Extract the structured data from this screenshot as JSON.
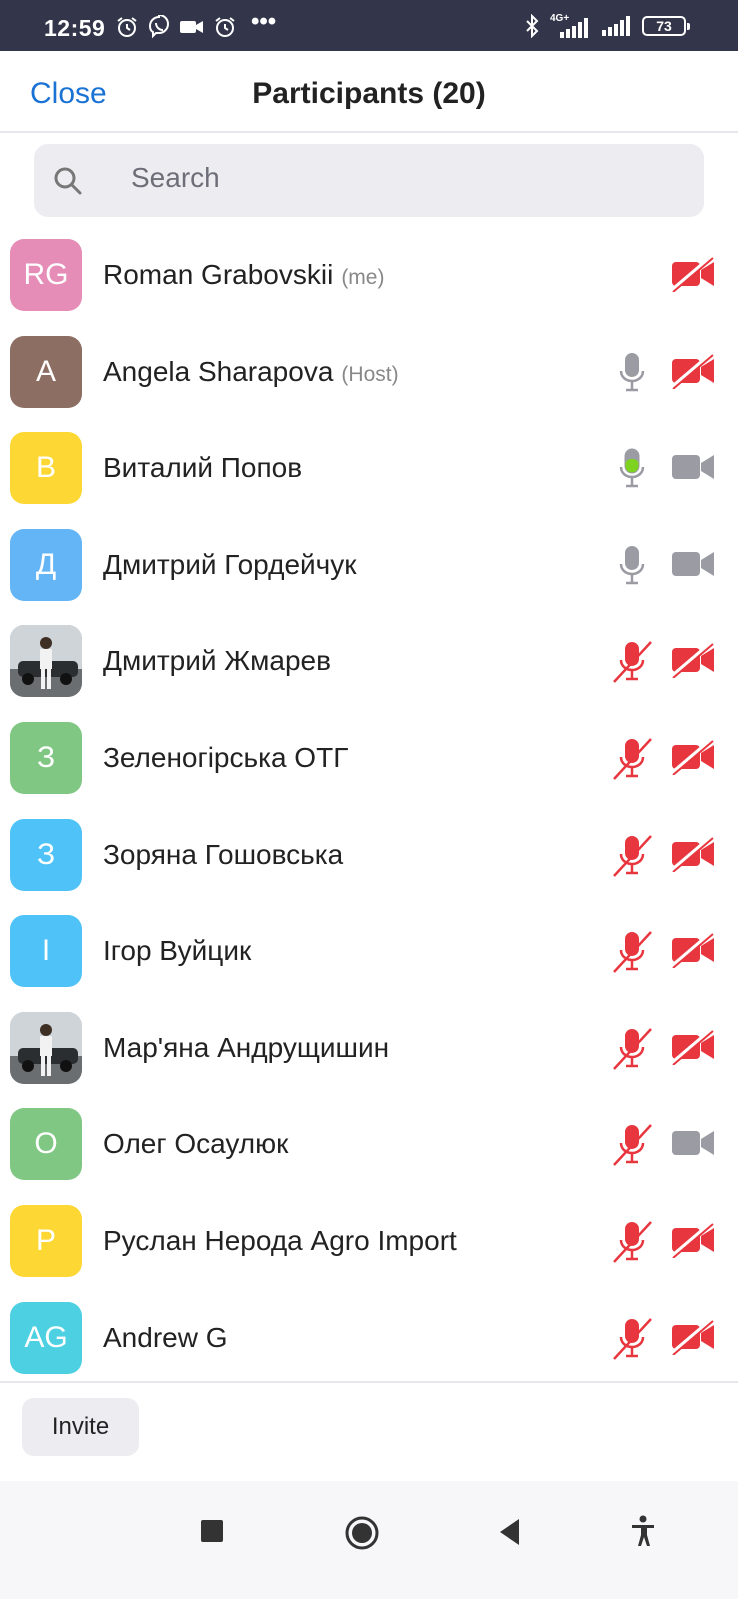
{
  "status_bar": {
    "time": "12:59",
    "dots": "•••",
    "net_label_top": "4G+",
    "battery": "73"
  },
  "header": {
    "close_label": "Close",
    "title": "Participants (20)"
  },
  "search": {
    "placeholder": "Search"
  },
  "colors": {
    "accent": "#1a73d4",
    "muted_red": "#e8363f",
    "active_green": "#7ed321",
    "icon_gray": "#9b9ba3"
  },
  "participants": [
    {
      "initials": "RG",
      "name": "Roman Grabovskii",
      "tag": "(me)",
      "avatar_color": "#e58cb7",
      "photo": false,
      "mic": "none",
      "cam": "off"
    },
    {
      "initials": "A",
      "name": "Angela Sharapova",
      "tag": "(Host)",
      "avatar_color": "#8d6e63",
      "photo": false,
      "mic": "on",
      "cam": "off"
    },
    {
      "initials": "В",
      "name": "Виталий Попов",
      "tag": "",
      "avatar_color": "#fdd835",
      "photo": false,
      "mic": "speaking",
      "cam": "on"
    },
    {
      "initials": "Д",
      "name": "Дмитрий Гордейчук",
      "tag": "",
      "avatar_color": "#64b5f6",
      "photo": false,
      "mic": "on",
      "cam": "on"
    },
    {
      "initials": "",
      "name": "Дмитрий Жмарев",
      "tag": "",
      "avatar_color": "#9aa0a6",
      "photo": true,
      "mic": "muted",
      "cam": "off"
    },
    {
      "initials": "З",
      "name": "Зеленогірська ОТГ",
      "tag": "",
      "avatar_color": "#81c784",
      "photo": false,
      "mic": "muted",
      "cam": "off"
    },
    {
      "initials": "З",
      "name": "Зоряна Гошовська",
      "tag": "",
      "avatar_color": "#4fc3f7",
      "photo": false,
      "mic": "muted",
      "cam": "off"
    },
    {
      "initials": "І",
      "name": "Ігор Вуйцик",
      "tag": "",
      "avatar_color": "#4fc3f7",
      "photo": false,
      "mic": "muted",
      "cam": "off"
    },
    {
      "initials": "",
      "name": "Мар'яна Андрущишин",
      "tag": "",
      "avatar_color": "#b0bec5",
      "photo": true,
      "mic": "muted",
      "cam": "off"
    },
    {
      "initials": "О",
      "name": "Олег Осаулюк",
      "tag": "",
      "avatar_color": "#81c784",
      "photo": false,
      "mic": "muted",
      "cam": "on"
    },
    {
      "initials": "Р",
      "name": "Руслан Нерода Agro Import",
      "tag": "",
      "avatar_color": "#fdd835",
      "photo": false,
      "mic": "muted",
      "cam": "off"
    },
    {
      "initials": "AG",
      "name": "Andrew G",
      "tag": "",
      "avatar_color": "#4dd0e1",
      "photo": false,
      "mic": "muted",
      "cam": "off"
    }
  ],
  "footer": {
    "invite_label": "Invite"
  },
  "nav": {
    "items": [
      "recents-square-icon",
      "home-circle-icon",
      "back-triangle-icon",
      "accessibility-icon"
    ]
  }
}
